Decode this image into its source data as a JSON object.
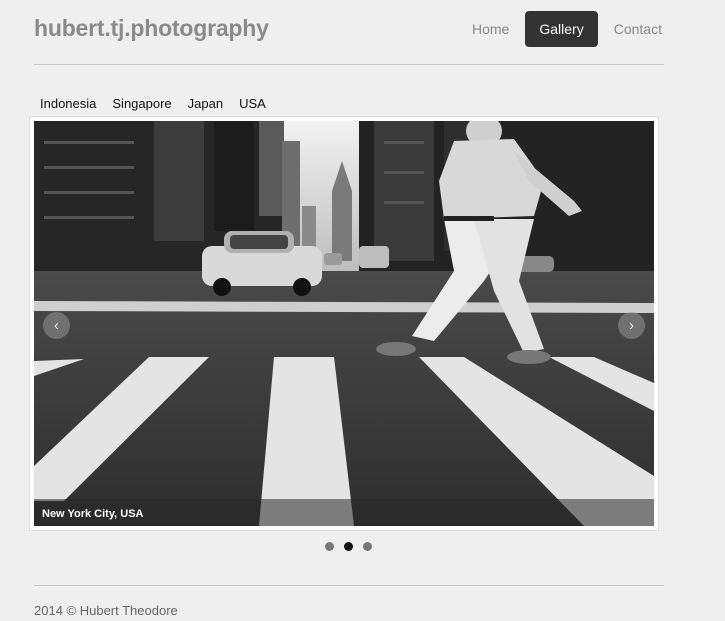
{
  "header": {
    "brand": "hubert.tj.photography",
    "nav": [
      {
        "label": "Home",
        "active": false
      },
      {
        "label": "Gallery",
        "active": true
      },
      {
        "label": "Contact",
        "active": false
      }
    ]
  },
  "tabs": [
    "Indonesia",
    "Singapore",
    "Japan",
    "USA"
  ],
  "carousel": {
    "caption": "New York City, USA",
    "prev_icon": "chevron-left-icon",
    "next_icon": "chevron-right-icon",
    "prev_glyph": "‹",
    "next_glyph": "›",
    "slide_count": 3,
    "active_slide": 2
  },
  "footer": {
    "text": "2014 © Hubert Theodore"
  },
  "colors": {
    "background": "#efefef",
    "nav_active": "#333333",
    "brand": "#8a8a8a"
  }
}
